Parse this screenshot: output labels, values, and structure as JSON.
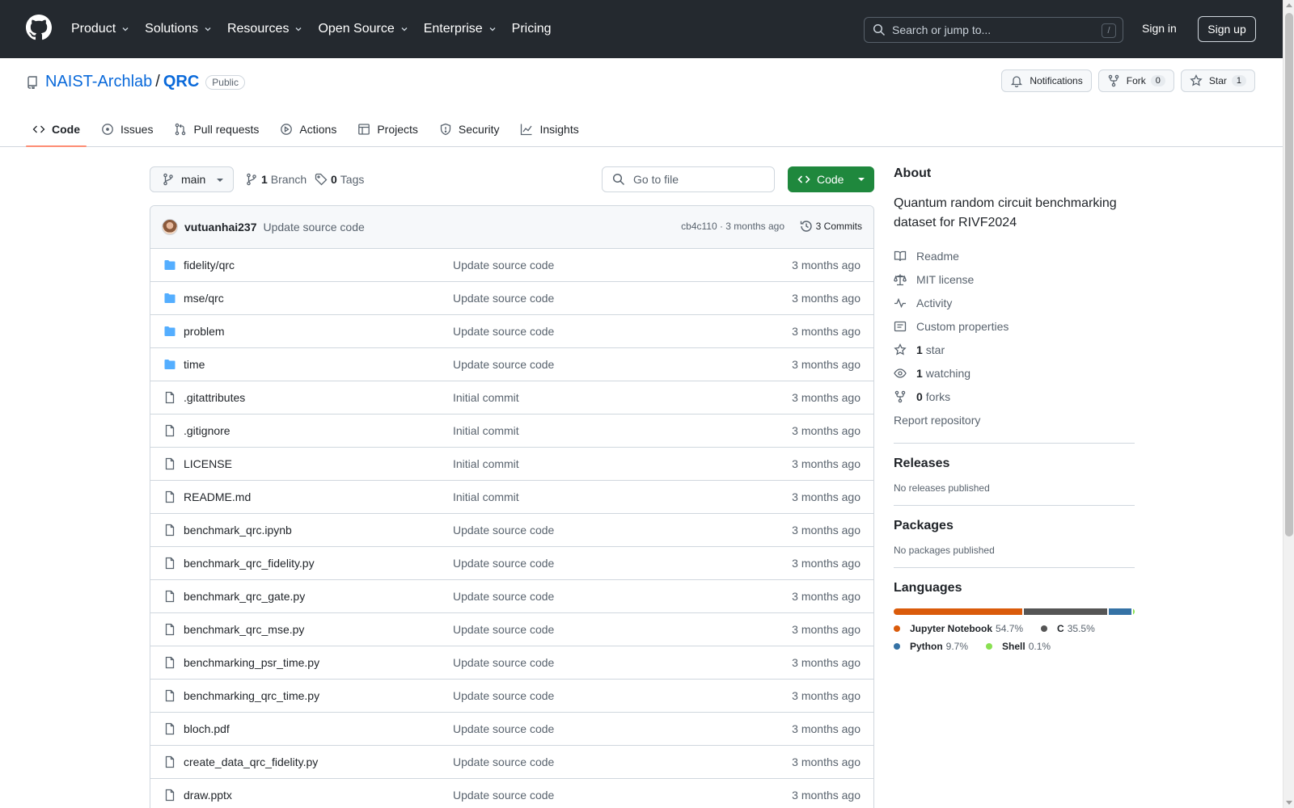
{
  "header": {
    "nav": [
      {
        "label": "Product",
        "dropdown": true
      },
      {
        "label": "Solutions",
        "dropdown": true
      },
      {
        "label": "Resources",
        "dropdown": true
      },
      {
        "label": "Open Source",
        "dropdown": true
      },
      {
        "label": "Enterprise",
        "dropdown": true
      },
      {
        "label": "Pricing",
        "dropdown": false
      }
    ],
    "search_placeholder": "Search or jump to...",
    "search_shortcut": "/",
    "sign_in": "Sign in",
    "sign_up": "Sign up"
  },
  "repo": {
    "owner": "NAIST-Archlab",
    "separator": "/",
    "name": "QRC",
    "visibility": "Public",
    "notifications_label": "Notifications",
    "fork_label": "Fork",
    "fork_count": "0",
    "star_label": "Star",
    "star_count": "1",
    "tabs": [
      {
        "label": "Code",
        "icon": "code-icon",
        "active": true
      },
      {
        "label": "Issues",
        "icon": "issue-icon",
        "active": false
      },
      {
        "label": "Pull requests",
        "icon": "pull-request-icon",
        "active": false
      },
      {
        "label": "Actions",
        "icon": "play-icon",
        "active": false
      },
      {
        "label": "Projects",
        "icon": "table-icon",
        "active": false
      },
      {
        "label": "Security",
        "icon": "shield-icon",
        "active": false
      },
      {
        "label": "Insights",
        "icon": "graph-icon",
        "active": false
      }
    ]
  },
  "toolbar": {
    "branch": "main",
    "branch_count": "1",
    "branch_label": "Branch",
    "tag_count": "0",
    "tag_label": "Tags",
    "goto_placeholder": "Go to file",
    "code_button": "Code"
  },
  "commit": {
    "author": "vutuanhai237",
    "message": "Update source code",
    "hash_time": "cb4c110 · 3 months ago",
    "commits_label": "3 Commits"
  },
  "files": [
    {
      "name": "fidelity/qrc",
      "type": "folder",
      "message": "Update source code",
      "date": "3 months ago"
    },
    {
      "name": "mse/qrc",
      "type": "folder",
      "message": "Update source code",
      "date": "3 months ago"
    },
    {
      "name": "problem",
      "type": "folder",
      "message": "Update source code",
      "date": "3 months ago"
    },
    {
      "name": "time",
      "type": "folder",
      "message": "Update source code",
      "date": "3 months ago"
    },
    {
      "name": ".gitattributes",
      "type": "file",
      "message": "Initial commit",
      "date": "3 months ago"
    },
    {
      "name": ".gitignore",
      "type": "file",
      "message": "Initial commit",
      "date": "3 months ago"
    },
    {
      "name": "LICENSE",
      "type": "file",
      "message": "Initial commit",
      "date": "3 months ago"
    },
    {
      "name": "README.md",
      "type": "file",
      "message": "Initial commit",
      "date": "3 months ago"
    },
    {
      "name": "benchmark_qrc.ipynb",
      "type": "file",
      "message": "Update source code",
      "date": "3 months ago"
    },
    {
      "name": "benchmark_qrc_fidelity.py",
      "type": "file",
      "message": "Update source code",
      "date": "3 months ago"
    },
    {
      "name": "benchmark_qrc_gate.py",
      "type": "file",
      "message": "Update source code",
      "date": "3 months ago"
    },
    {
      "name": "benchmark_qrc_mse.py",
      "type": "file",
      "message": "Update source code",
      "date": "3 months ago"
    },
    {
      "name": "benchmarking_psr_time.py",
      "type": "file",
      "message": "Update source code",
      "date": "3 months ago"
    },
    {
      "name": "benchmarking_qrc_time.py",
      "type": "file",
      "message": "Update source code",
      "date": "3 months ago"
    },
    {
      "name": "bloch.pdf",
      "type": "file",
      "message": "Update source code",
      "date": "3 months ago"
    },
    {
      "name": "create_data_qrc_fidelity.py",
      "type": "file",
      "message": "Update source code",
      "date": "3 months ago"
    },
    {
      "name": "draw.pptx",
      "type": "file",
      "message": "Update source code",
      "date": "3 months ago"
    }
  ],
  "about": {
    "title": "About",
    "description": "Quantum random circuit benchmarking dataset for RIVF2024",
    "items": [
      {
        "icon": "book-icon",
        "bold": "",
        "label": "Readme"
      },
      {
        "icon": "law-icon",
        "bold": "",
        "label": "MIT license"
      },
      {
        "icon": "pulse-icon",
        "bold": "",
        "label": "Activity"
      },
      {
        "icon": "note-icon",
        "bold": "",
        "label": "Custom properties"
      },
      {
        "icon": "star-icon",
        "bold": "1",
        "label": "star"
      },
      {
        "icon": "eye-icon",
        "bold": "1",
        "label": "watching"
      },
      {
        "icon": "fork-icon",
        "bold": "0",
        "label": "forks"
      }
    ],
    "report": "Report repository"
  },
  "releases": {
    "title": "Releases",
    "empty": "No releases published"
  },
  "packages": {
    "title": "Packages",
    "empty": "No packages published"
  },
  "languages": {
    "title": "Languages",
    "items": [
      {
        "name": "Jupyter Notebook",
        "percent": "54.7%",
        "value": 54.7,
        "color": "#DA5B0B"
      },
      {
        "name": "C",
        "percent": "35.5%",
        "value": 35.5,
        "color": "#555555"
      },
      {
        "name": "Python",
        "percent": "9.7%",
        "value": 9.7,
        "color": "#3572A5"
      },
      {
        "name": "Shell",
        "percent": "0.1%",
        "value": 0.1,
        "color": "#89e051"
      }
    ]
  }
}
